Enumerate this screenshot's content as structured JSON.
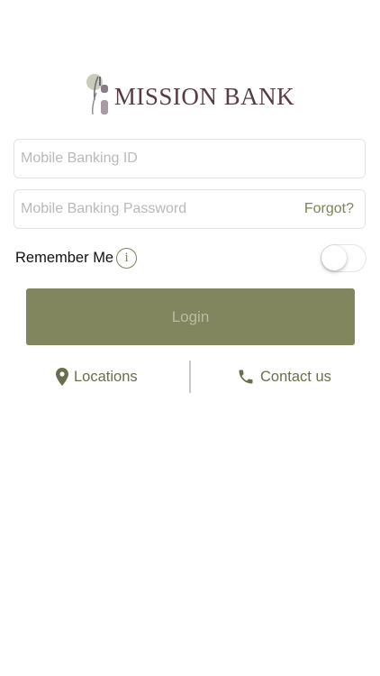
{
  "brand": {
    "name": "MISSION BANK",
    "accent_color": "#82865e",
    "link_color": "#7f8258",
    "logo_text_color": "#5b3a48"
  },
  "login_form": {
    "id_placeholder": "Mobile Banking ID",
    "password_placeholder": "Mobile Banking Password",
    "forgot_label": "Forgot?",
    "remember_label": "Remember Me",
    "info_icon": "info-icon",
    "remember_on": false,
    "login_label": "Login"
  },
  "links": {
    "locations_label": "Locations",
    "locations_icon": "map-pin-icon",
    "contact_label": "Contact us",
    "contact_icon": "phone-icon"
  }
}
